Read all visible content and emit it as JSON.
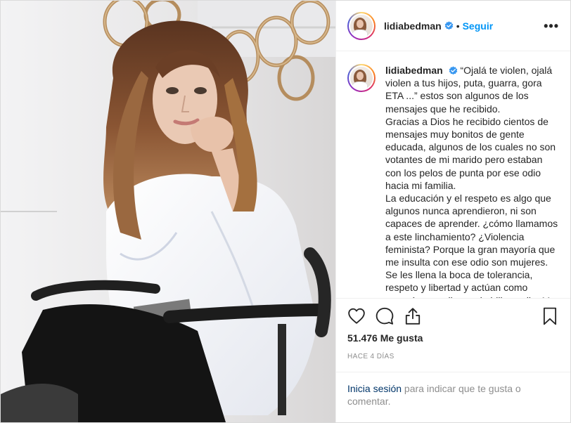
{
  "post": {
    "username": "lidiabedman",
    "follow_label": "Seguir",
    "separator": "•",
    "more_label": "•••",
    "caption_paragraphs": [
      "“Ojalá te violen, ojalá violen a tus hijos, puta, guarra, gora ETA ...” estos son algunos de los mensajes que he recibido.",
      "Gracias a Dios he recibido cientos de mensajes muy bonitos de gente educada, algunos de los cuales no son votantes de mi marido pero estaban con los pelos de punta por ese odio hacia mi familia.",
      "La educación y el respeto es algo que algunos nunca aprendieron, ni son capaces de aprender. ¿cómo llamamos a este linchamiento? ¿Violencia feminista? Porque la gran mayoría que me insulta con ese odio son mujeres.",
      "Se les llena la boca de tolerancia, respeto y libertad y actúan como energúmenos llenos de bilis y odio. Me llama mucho la atención que alguien"
    ],
    "likes": "51.476 Me gusta",
    "time_ago": "HACE 4 DÍAS",
    "login_link": "Inicia sesión",
    "login_text": " para indicar que te gusta o comentar."
  },
  "icons": {
    "verified": "verified-badge-icon",
    "like": "heart-icon",
    "comment": "speech-bubble-icon",
    "share": "share-arrow-icon",
    "save": "bookmark-icon"
  },
  "colors": {
    "accent": "#0095f6",
    "verified": "#3897f0",
    "link_dark": "#003569",
    "muted": "#8e8e8e",
    "border": "#efefef"
  }
}
